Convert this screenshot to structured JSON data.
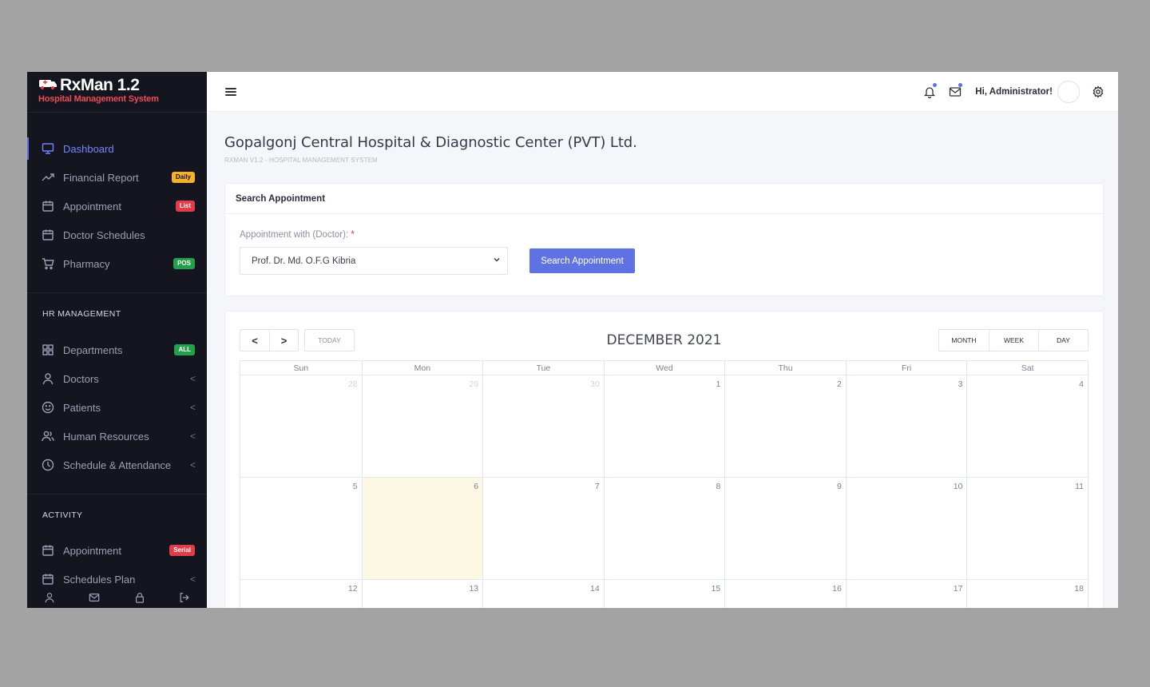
{
  "brand": {
    "name": "RxMan 1.2",
    "subtitle": "Hospital Management System"
  },
  "sidebar": {
    "items": [
      {
        "label": "Dashboard",
        "icon": "monitor-icon",
        "active": true
      },
      {
        "label": "Financial Report",
        "icon": "trending-up-icon",
        "badge": "Daily",
        "badge_color": "#f5b225"
      },
      {
        "label": "Appointment",
        "icon": "calendar-icon",
        "badge": "List",
        "badge_color": "#e23b49"
      },
      {
        "label": "Doctor Schedules",
        "icon": "calendar-icon"
      },
      {
        "label": "Pharmacy",
        "icon": "cart-icon",
        "badge": "POS",
        "badge_color": "#22a04a"
      }
    ],
    "hr_title": "HR MANAGEMENT",
    "hr_items": [
      {
        "label": "Departments",
        "icon": "grid-icon",
        "badge": "ALL",
        "badge_color": "#22a04a"
      },
      {
        "label": "Doctors",
        "icon": "user-icon"
      },
      {
        "label": "Patients",
        "icon": "smile-icon"
      },
      {
        "label": "Human Resources",
        "icon": "users-icon"
      },
      {
        "label": "Schedule & Attendance",
        "icon": "clock-icon"
      }
    ],
    "activity_title": "ACTIVITY",
    "activity_items": [
      {
        "label": "Appointment",
        "icon": "calendar-icon",
        "badge": "Serial",
        "badge_color": "#e23b49"
      },
      {
        "label": "Schedules Plan",
        "icon": "calendar-icon"
      }
    ],
    "chevron": "<"
  },
  "topbar": {
    "greeting": "Hi, Administrator!"
  },
  "page": {
    "title": "Gopalgonj Central Hospital & Diagnostic Center (PVT) Ltd.",
    "subtitle": "RXMAN V1.2 - HOSPITAL MANAGEMENT SYSTEM"
  },
  "search": {
    "card_title": "Search Appointment",
    "label": "Appointment with (Doctor):",
    "required_mark": "*",
    "selected_doctor": "Prof. Dr. Md. O.F.G Kibria",
    "button": "Search Appointment"
  },
  "calendar": {
    "title": "DECEMBER 2021",
    "today_label": "TODAY",
    "prev": "<",
    "next": ">",
    "views": [
      "MONTH",
      "WEEK",
      "DAY"
    ],
    "weekdays": [
      "Sun",
      "Mon",
      "Tue",
      "Wed",
      "Thu",
      "Fri",
      "Sat"
    ],
    "weeks": [
      [
        "28",
        "29",
        "30",
        "1",
        "2",
        "3",
        "4"
      ],
      [
        "5",
        "6",
        "7",
        "8",
        "9",
        "10",
        "11"
      ],
      [
        "12",
        "13",
        "14",
        "15",
        "16",
        "17",
        "18"
      ]
    ]
  },
  "colors": {
    "accent": "#5e72e4",
    "sidebar_bg": "#15151f",
    "today_bg": "#fcf8e3"
  }
}
